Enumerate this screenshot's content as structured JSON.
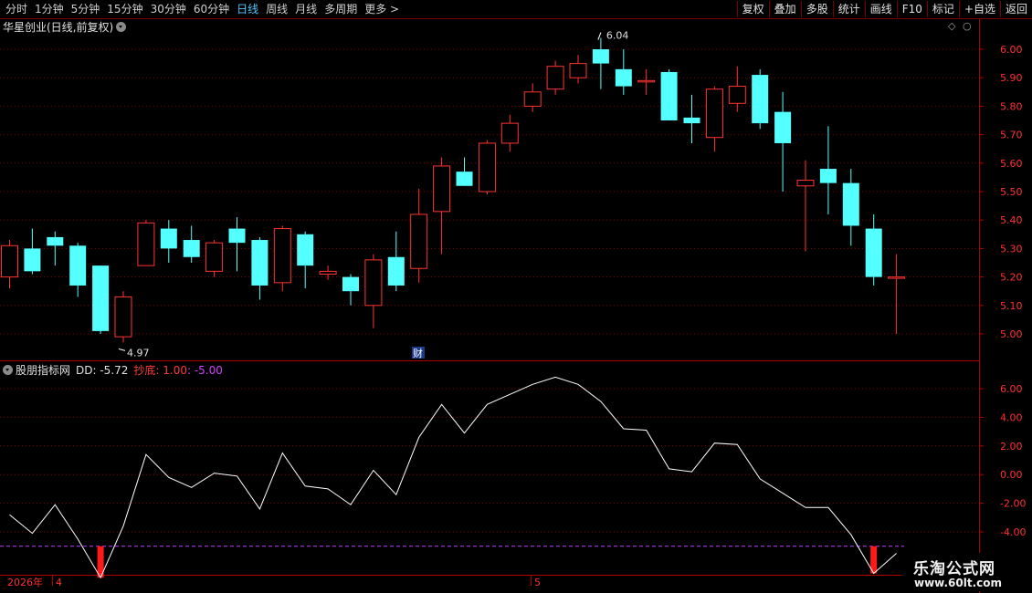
{
  "toolbar": {
    "periods": [
      "分时",
      "1分钟",
      "5分钟",
      "15分钟",
      "30分钟",
      "60分钟",
      "日线",
      "周线",
      "月线",
      "多周期",
      "更多 >"
    ],
    "active_period": "日线",
    "buttons": [
      "复权",
      "叠加",
      "多股",
      "统计",
      "画线",
      "F10",
      "标记",
      "+自选",
      "返回"
    ]
  },
  "stock": {
    "title": "华星创业(日线,前复权)"
  },
  "indicator": {
    "name": "股朋指标网",
    "dd_label": "DD: -5.72",
    "cd_label": "抄底: 1.00",
    "cd_value": ": -5.00"
  },
  "price_axis": {
    "ticks": [
      "6.00",
      "5.90",
      "5.80",
      "5.70",
      "5.60",
      "5.50",
      "5.40",
      "5.30",
      "5.20",
      "5.10",
      "5.00"
    ]
  },
  "ind_axis": {
    "ticks": [
      "6.00",
      "4.00",
      "2.00",
      "0.00",
      "-2.00",
      "-4.00"
    ]
  },
  "labels": {
    "high": "6.04",
    "low": "4.97",
    "cai": "财"
  },
  "time_axis": {
    "year": "2026年",
    "m1": "4",
    "m2": "5"
  },
  "watermark": {
    "title": "乐淘公式网",
    "url": "www.60lt.com"
  },
  "colors": {
    "up": "#ff3333",
    "down": "#54ffff",
    "grid": "#8b0000",
    "line": "#ffffff",
    "signal": "#ff1a1a",
    "ref": "#c040ff"
  },
  "chart_data": {
    "type": "candlestick",
    "candles": [
      [
        5.2,
        5.31,
        5.33,
        5.16
      ],
      [
        5.3,
        5.22,
        5.37,
        5.21
      ],
      [
        5.34,
        5.31,
        5.36,
        5.24
      ],
      [
        5.31,
        5.17,
        5.32,
        5.13
      ],
      [
        5.24,
        5.01,
        5.24,
        5.0
      ],
      [
        4.99,
        5.13,
        5.15,
        4.97
      ],
      [
        5.24,
        5.39,
        5.4,
        5.24
      ],
      [
        5.37,
        5.3,
        5.4,
        5.25
      ],
      [
        5.33,
        5.27,
        5.38,
        5.25
      ],
      [
        5.22,
        5.32,
        5.33,
        5.2
      ],
      [
        5.37,
        5.32,
        5.41,
        5.22
      ],
      [
        5.33,
        5.17,
        5.34,
        5.12
      ],
      [
        5.18,
        5.37,
        5.38,
        5.15
      ],
      [
        5.35,
        5.24,
        5.36,
        5.16
      ],
      [
        5.21,
        5.22,
        5.24,
        5.19
      ],
      [
        5.2,
        5.15,
        5.21,
        5.1
      ],
      [
        5.1,
        5.26,
        5.28,
        5.02
      ],
      [
        5.27,
        5.17,
        5.36,
        5.15
      ],
      [
        5.23,
        5.42,
        5.51,
        5.18
      ],
      [
        5.43,
        5.59,
        5.62,
        5.28
      ],
      [
        5.57,
        5.52,
        5.62,
        5.52
      ],
      [
        5.5,
        5.67,
        5.68,
        5.49
      ],
      [
        5.67,
        5.74,
        5.77,
        5.64
      ],
      [
        5.8,
        5.85,
        5.88,
        5.78
      ],
      [
        5.86,
        5.94,
        5.96,
        5.84
      ],
      [
        5.9,
        5.95,
        5.98,
        5.88
      ],
      [
        6.0,
        5.95,
        6.04,
        5.86
      ],
      [
        5.93,
        5.87,
        6.0,
        5.84
      ],
      [
        5.89,
        5.89,
        5.93,
        5.84
      ],
      [
        5.92,
        5.75,
        5.93,
        5.75
      ],
      [
        5.76,
        5.74,
        5.84,
        5.67
      ],
      [
        5.69,
        5.86,
        5.87,
        5.64
      ],
      [
        5.81,
        5.87,
        5.94,
        5.78
      ],
      [
        5.91,
        5.74,
        5.93,
        5.72
      ],
      [
        5.78,
        5.67,
        5.85,
        5.5
      ],
      [
        5.52,
        5.54,
        5.61,
        5.29
      ],
      [
        5.58,
        5.53,
        5.73,
        5.42
      ],
      [
        5.53,
        5.38,
        5.58,
        5.31
      ],
      [
        5.37,
        5.2,
        5.42,
        5.17
      ],
      [
        5.2,
        5.2,
        5.28,
        5.0
      ]
    ],
    "indicator_series": [
      -2.8,
      -4.1,
      -2.1,
      -4.5,
      -7.2,
      -3.6,
      1.4,
      -0.2,
      -0.9,
      0.1,
      -0.1,
      -2.4,
      1.5,
      -0.8,
      -1.0,
      -2.1,
      0.3,
      -1.4,
      2.6,
      4.9,
      2.9,
      4.9,
      5.6,
      6.3,
      6.8,
      6.3,
      5.1,
      3.2,
      3.1,
      0.4,
      0.2,
      2.2,
      2.1,
      -0.3,
      -1.3,
      -2.3,
      -2.3,
      -4.2,
      -6.9,
      -5.5
    ],
    "buy_signals": [
      4,
      38
    ],
    "ref_level": -5.0,
    "price_range": [
      4.97,
      6.04
    ],
    "ind_range": [
      -7.2,
      6.8
    ]
  }
}
